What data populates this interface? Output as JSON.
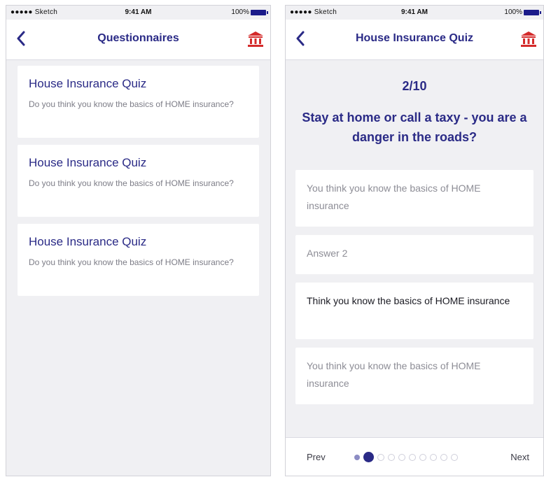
{
  "status_bar": {
    "carrier": "●●●●● Sketch",
    "time": "9:41 AM",
    "battery": "100%",
    "accent": "#1b1b8a"
  },
  "colors": {
    "primary": "#2a2a86",
    "bank_icon": "#d42b2b",
    "background": "#f0f0f3",
    "card": "#ffffff"
  },
  "left_screen": {
    "title": "Questionnaires",
    "back_icon": "chevron-left-icon",
    "bank_icon": "bank-icon",
    "cards": [
      {
        "title": "House Insurance Quiz",
        "description": "Do you think you know the basics of HOME insurance?"
      },
      {
        "title": "House Insurance Quiz",
        "description": "Do you think you know the basics of HOME insurance?"
      },
      {
        "title": "House Insurance Quiz",
        "description": "Do you think you know the basics of HOME insurance?"
      }
    ]
  },
  "right_screen": {
    "title": "House Insurance Quiz",
    "back_icon": "chevron-left-icon",
    "bank_icon": "bank-icon",
    "counter": "2/10",
    "question": "Stay at home or call a taxy - you are a danger in the roads?",
    "answers": [
      {
        "text": "You think you know the basics of HOME insurance",
        "selected": false
      },
      {
        "text": "Answer 2",
        "selected": false
      },
      {
        "text": "Think you know the basics of HOME insurance",
        "selected": true
      },
      {
        "text": "You think you know the basics of HOME insurance",
        "selected": false
      }
    ],
    "pager": {
      "prev_label": "Prev",
      "next_label": "Next",
      "current_index": 2,
      "total": 10
    }
  }
}
